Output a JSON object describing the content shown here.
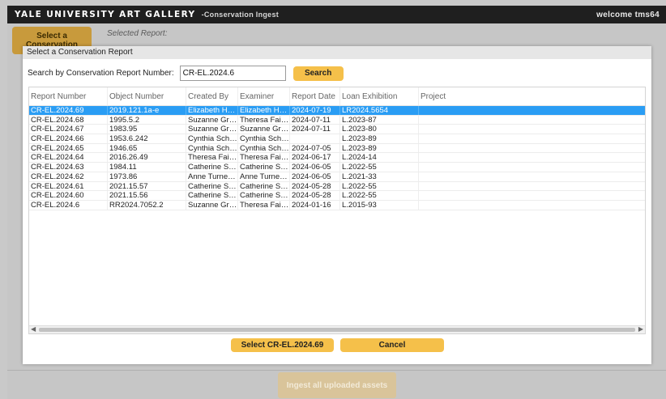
{
  "topbar": {
    "brand": "YALE UNIVERSITY ART GALLERY",
    "subtitle": "-Conservation Ingest",
    "welcome": "welcome tms64"
  },
  "background": {
    "select_button": "Select a Conservation Report",
    "selected_report_label": "Selected Report:",
    "ingest_button": "Ingest all uploaded assets"
  },
  "dialog": {
    "title": "Select a Conservation Report",
    "search_label": "Search by Conservation Report Number:",
    "search_value": "CR-EL.2024.6",
    "search_button": "Search",
    "select_button": "Select CR-EL.2024.69",
    "cancel_button": "Cancel",
    "columns": [
      "Report Number",
      "Object Number",
      "Created By",
      "Examiner",
      "Report Date",
      "Loan Exhibition",
      "Project"
    ],
    "rows": [
      [
        "CR-EL.2024.69",
        "2019.121.1a-e",
        "Elizabeth Ha...",
        "Elizabeth Ha...",
        "2024-07-19",
        "LR2024.5654",
        ""
      ],
      [
        "CR-EL.2024.68",
        "1995.5.2",
        "Suzanne Gre...",
        "Theresa Fair...",
        "2024-07-11",
        "L.2023-87",
        ""
      ],
      [
        "CR-EL.2024.67",
        "1983.95",
        "Suzanne Gre...",
        "Suzanne Gre...",
        "2024-07-11",
        "L.2023-80",
        ""
      ],
      [
        "CR-EL.2024.66",
        "1953.6.242",
        "Cynthia Schw...",
        "Cynthia Schw...",
        "",
        "L.2023-89",
        ""
      ],
      [
        "CR-EL.2024.65",
        "1946.65",
        "Cynthia Schw...",
        "Cynthia Schw...",
        "2024-07-05",
        "L.2023-89",
        ""
      ],
      [
        "CR-EL.2024.64",
        "2016.26.49",
        "Theresa Fair...",
        "Theresa Fair...",
        "2024-06-17",
        "L.2024-14",
        ""
      ],
      [
        "CR-EL.2024.63",
        "1984.11",
        "Catherine Sil...",
        "Catherine Sil...",
        "2024-06-05",
        "L.2022-55",
        ""
      ],
      [
        "CR-EL.2024.62",
        "1973.86",
        "Anne Turner ...",
        "Anne Turner ...",
        "2024-06-05",
        "L.2021-33",
        ""
      ],
      [
        "CR-EL.2024.61",
        "2021.15.57",
        "Catherine Sil...",
        "Catherine Sil...",
        "2024-05-28",
        "L.2022-55",
        ""
      ],
      [
        "CR-EL.2024.60",
        "2021.15.56",
        "Catherine Sil...",
        "Catherine Sil...",
        "2024-05-28",
        "L.2022-55",
        ""
      ],
      [
        "CR-EL.2024.6",
        "RR2024.7052.2",
        "Suzanne Gre...",
        "Theresa Fair...",
        "2024-01-16",
        "L.2015-93",
        ""
      ]
    ],
    "selected_row": 0,
    "colors": {
      "accent": "#f5c04a",
      "selection": "#2a9df4",
      "topbar": "#1f1f1f"
    }
  }
}
